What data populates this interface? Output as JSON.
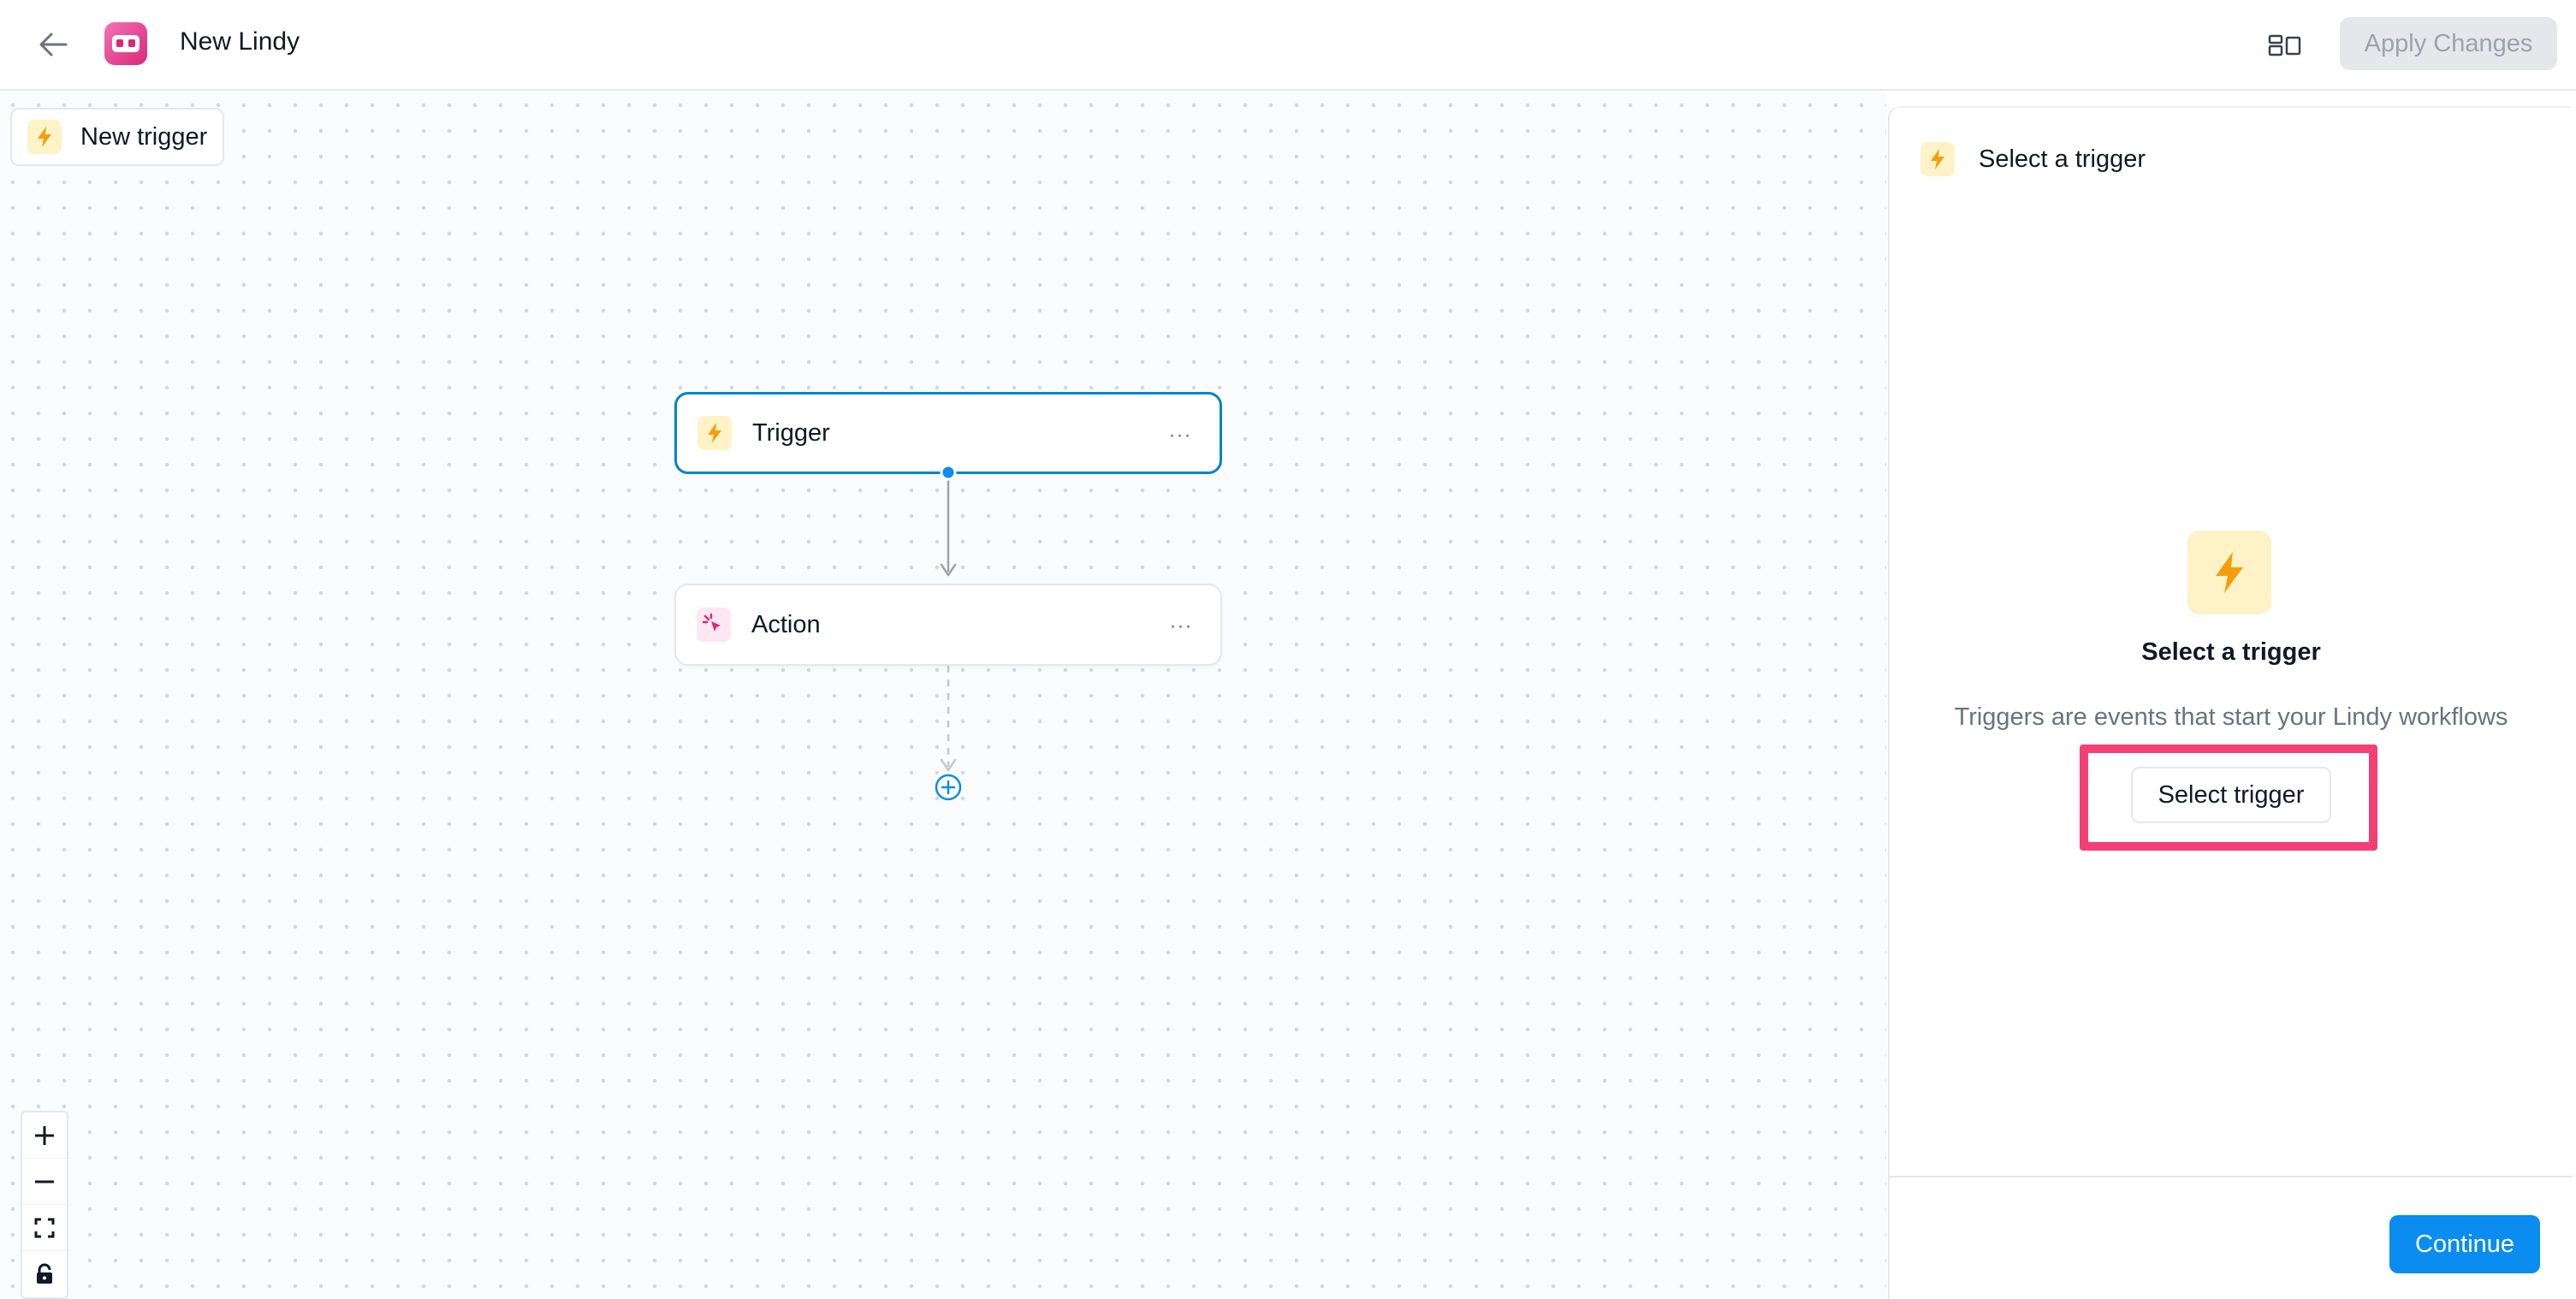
{
  "header": {
    "title": "New Lindy",
    "apply_label": "Apply Changes"
  },
  "canvas": {
    "new_trigger_label": "New trigger",
    "nodes": [
      {
        "label": "Trigger",
        "icon": "bolt-icon",
        "selected": true
      },
      {
        "label": "Action",
        "icon": "cursor-click-icon",
        "selected": false
      }
    ],
    "more_label": "···"
  },
  "panel": {
    "title": "Select a trigger",
    "empty_title": "Select a trigger",
    "empty_desc": "Triggers are events that start your Lindy workflows",
    "select_button": "Select trigger",
    "continue_button": "Continue"
  },
  "colors": {
    "accent": "#0284c7",
    "primary_button": "#0a8cf0",
    "bolt": "#f59e0b",
    "highlight": "#f43f75"
  }
}
